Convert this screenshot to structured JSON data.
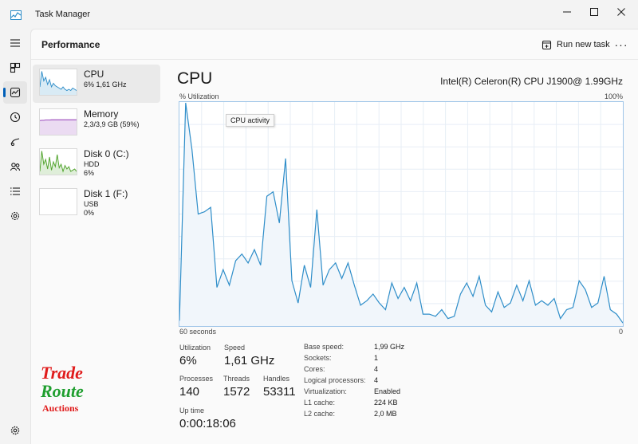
{
  "window": {
    "title": "Task Manager"
  },
  "page": {
    "title": "Performance",
    "run_new_task": "Run new task",
    "more": "···"
  },
  "nav": [
    {
      "icon": "hamburger-menu-icon"
    },
    {
      "icon": "processes-icon"
    },
    {
      "icon": "performance-icon",
      "active": true
    },
    {
      "icon": "app-history-icon"
    },
    {
      "icon": "startup-apps-icon"
    },
    {
      "icon": "users-icon"
    },
    {
      "icon": "details-icon"
    },
    {
      "icon": "services-icon"
    }
  ],
  "perf_items": [
    {
      "name": "CPU",
      "line1": "6% 1,61 GHz",
      "line2": "",
      "color": "#2f8ec9"
    },
    {
      "name": "Memory",
      "line1": "2,3/3,9 GB (59%)",
      "line2": "",
      "color": "#8f35b5"
    },
    {
      "name": "Disk 0 (C:)",
      "line1": "HDD",
      "line2": "6%",
      "color": "#4fa32a"
    },
    {
      "name": "Disk 1 (F:)",
      "line1": "USB",
      "line2": "0%",
      "color": "#4fa32a"
    }
  ],
  "logo": {
    "line1": "Trade",
    "line2": "Route",
    "line3": "Auctions"
  },
  "cpu": {
    "title": "CPU",
    "model": "Intel(R) Celeron(R) CPU J1900@ 1.99GHz",
    "y_label": "% Utilization",
    "y_max": "100%",
    "x_left": "60 seconds",
    "x_right": "0",
    "tooltip": "CPU activity",
    "line_color": "#2f8ec9",
    "fill_color": "#f1f6fb",
    "history_percent": [
      2,
      100,
      79,
      50,
      51,
      53,
      17,
      25,
      18,
      29,
      32,
      28,
      34,
      27,
      58,
      60,
      46,
      75,
      20,
      10,
      27,
      17,
      52,
      18,
      25,
      28,
      21,
      28,
      18,
      9,
      11,
      14,
      10,
      7,
      19,
      12,
      17,
      11,
      19,
      5,
      5,
      4,
      7,
      3,
      4,
      14,
      19,
      13,
      22,
      9,
      6,
      15,
      8,
      10,
      18,
      11,
      20,
      9,
      11,
      9,
      12,
      3,
      7,
      8,
      20,
      16,
      8,
      10,
      22,
      7,
      5,
      1
    ]
  },
  "stats": {
    "utilization": {
      "label": "Utilization",
      "value": "6%"
    },
    "speed": {
      "label": "Speed",
      "value": "1,61 GHz"
    },
    "processes": {
      "label": "Processes",
      "value": "140"
    },
    "threads": {
      "label": "Threads",
      "value": "1572"
    },
    "handles": {
      "label": "Handles",
      "value": "53311"
    },
    "uptime": {
      "label": "Up time",
      "value": "0:00:18:06"
    }
  },
  "specs": [
    {
      "key": "Base speed:",
      "value": "1,99 GHz"
    },
    {
      "key": "Sockets:",
      "value": "1"
    },
    {
      "key": "Cores:",
      "value": "4"
    },
    {
      "key": "Logical processors:",
      "value": "4"
    },
    {
      "key": "Virtualization:",
      "value": "Enabled"
    },
    {
      "key": "L1 cache:",
      "value": "224 KB"
    },
    {
      "key": "L2 cache:",
      "value": "2,0 MB"
    }
  ]
}
